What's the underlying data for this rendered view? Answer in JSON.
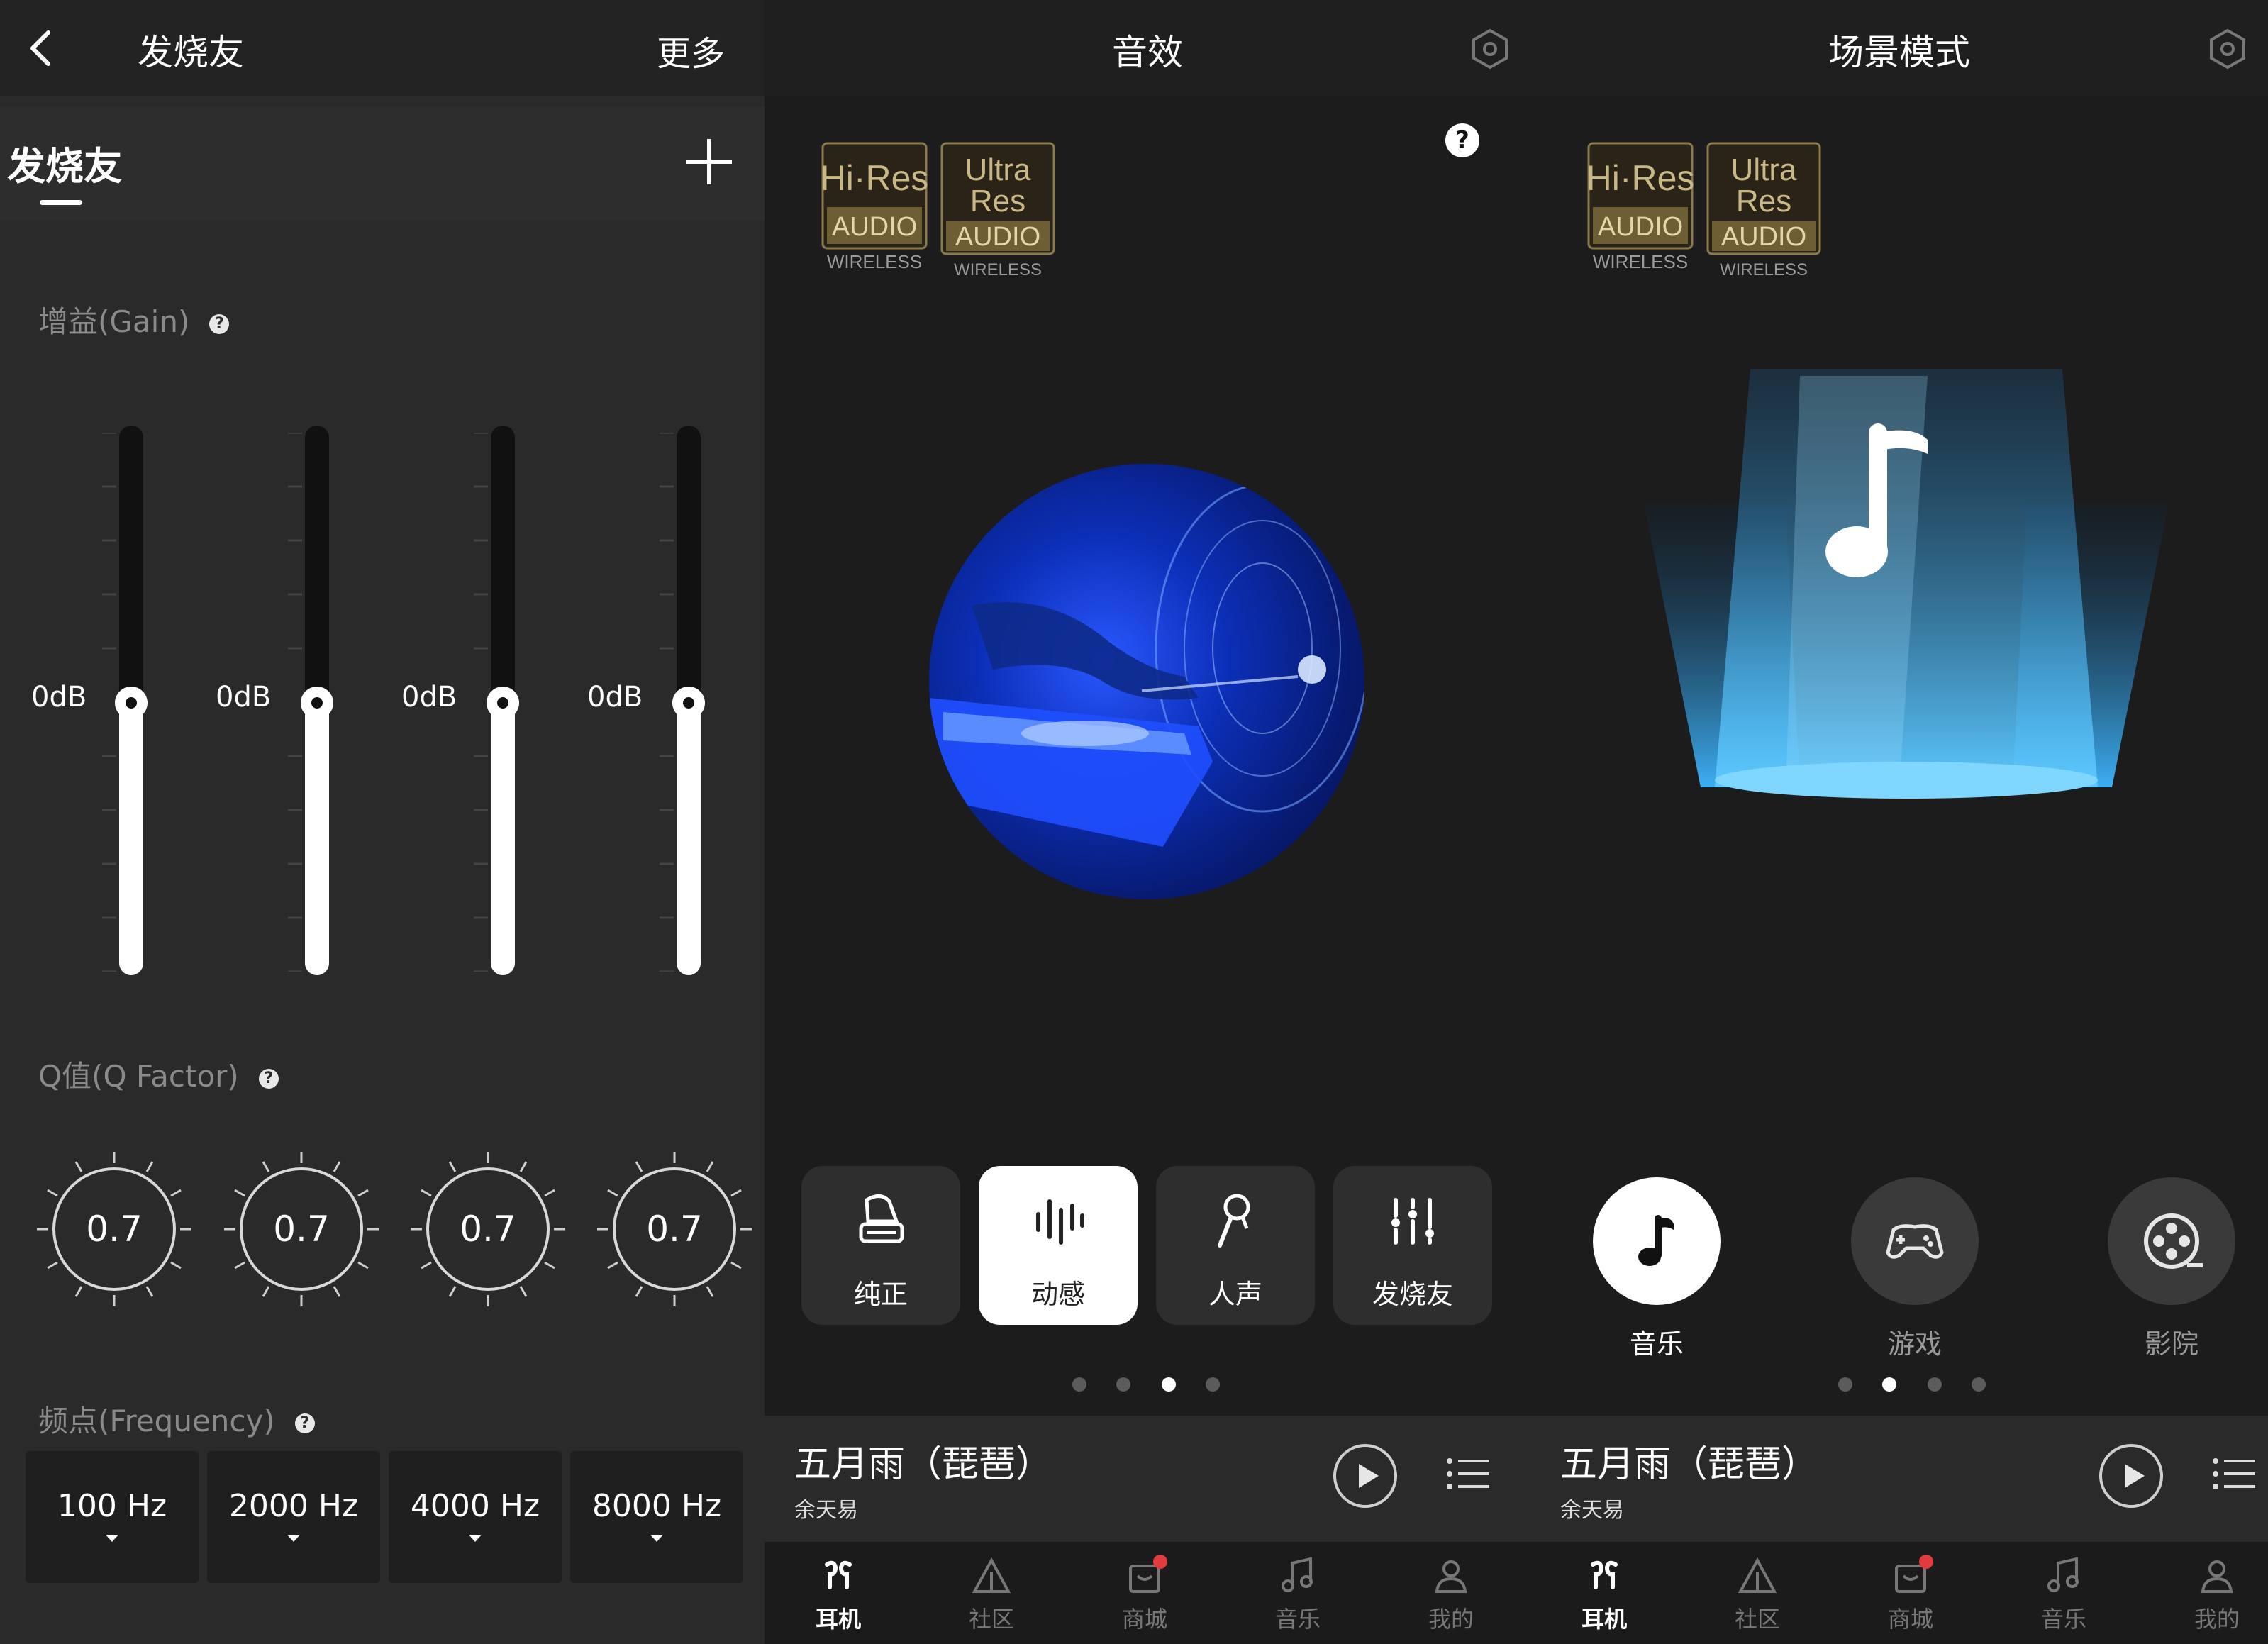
{
  "colors": {
    "accent": "#ffffff",
    "beam": "#3fb6ff",
    "disc": "#1f4fff",
    "badge_red": "#e23b3b"
  },
  "eq_panel": {
    "title": "发烧友",
    "more_label": "更多",
    "tab_label": "发烧友",
    "gain_label": "增益(Gain)",
    "q_label": "Q值(Q Factor)",
    "freq_label": "频点(Frequency)",
    "help_glyph": "?",
    "bands": [
      {
        "gain": "0dB",
        "q": "0.7",
        "freq": "100 Hz"
      },
      {
        "gain": "0dB",
        "q": "0.7",
        "freq": "2000 Hz"
      },
      {
        "gain": "0dB",
        "q": "0.7",
        "freq": "4000 Hz"
      },
      {
        "gain": "0dB",
        "q": "0.7",
        "freq": "8000 Hz"
      }
    ]
  },
  "effects_panel": {
    "title": "音效",
    "help_glyph": "?",
    "badges": {
      "hires": {
        "line1": "Hi·Res",
        "line2": "AUDIO",
        "line3": "WIRELESS"
      },
      "ultra": {
        "line1": "Ultra",
        "line2": "Res",
        "line3": "AUDIO",
        "line4": "WIRELESS"
      }
    },
    "effects": [
      {
        "label": "纯正",
        "icon": "gramophone-icon"
      },
      {
        "label": "动感",
        "icon": "waveform-icon",
        "selected": true
      },
      {
        "label": "人声",
        "icon": "microphone-icon"
      },
      {
        "label": "发烧友",
        "icon": "equalizer-icon"
      }
    ],
    "page_indicator": {
      "count": 4,
      "active": 3
    }
  },
  "scene_panel": {
    "title": "场景模式",
    "scenes": [
      {
        "label": "音乐",
        "icon": "music-note-icon",
        "selected": true
      },
      {
        "label": "游戏",
        "icon": "gamepad-icon"
      },
      {
        "label": "影院",
        "icon": "film-reel-icon"
      }
    ],
    "page_indicator": {
      "count": 4,
      "active": 2
    }
  },
  "player": {
    "song": "五月雨（琵琶）",
    "artist": "余天易"
  },
  "nav": [
    {
      "label": "耳机",
      "icon": "earbuds-icon",
      "active": true
    },
    {
      "label": "社区",
      "icon": "triangle-icon"
    },
    {
      "label": "商城",
      "icon": "shop-bag-icon",
      "badge": true
    },
    {
      "label": "音乐",
      "icon": "music-icon"
    },
    {
      "label": "我的",
      "icon": "person-icon"
    }
  ]
}
